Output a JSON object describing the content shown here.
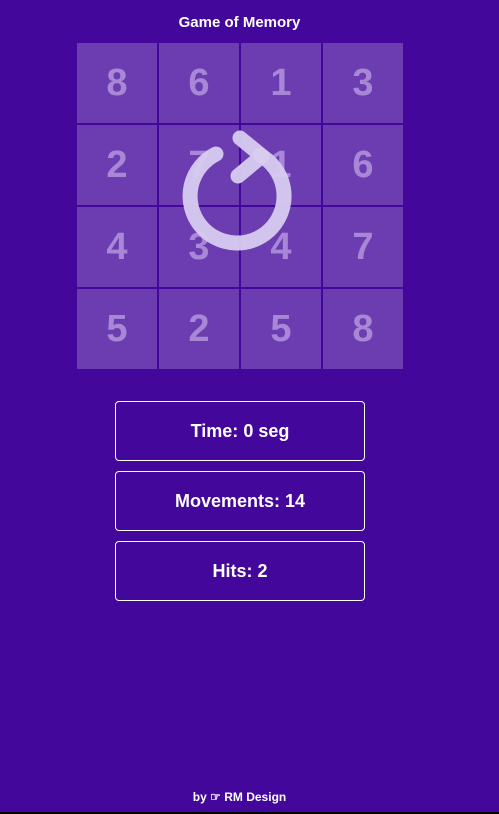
{
  "title": "Game of Memory",
  "board": {
    "cards": [
      "8",
      "6",
      "1",
      "3",
      "2",
      "7",
      "1",
      "6",
      "4",
      "3",
      "4",
      "7",
      "5",
      "2",
      "5",
      "8"
    ]
  },
  "stats": {
    "time_label": "Time:",
    "time_value": "0 seg",
    "movements_label": "Movements:",
    "movements_value": "14",
    "hits_label": "Hits:",
    "hits_value": "2"
  },
  "footer": {
    "by": "by",
    "hand_glyph": "☞",
    "author": "RM Design"
  },
  "icons": {
    "restart": "restart-icon"
  },
  "colors": {
    "background": "#43079b",
    "card": "#6b3db1",
    "card_text": "#a888d6",
    "overlay_icon": "#d8ccf0"
  }
}
